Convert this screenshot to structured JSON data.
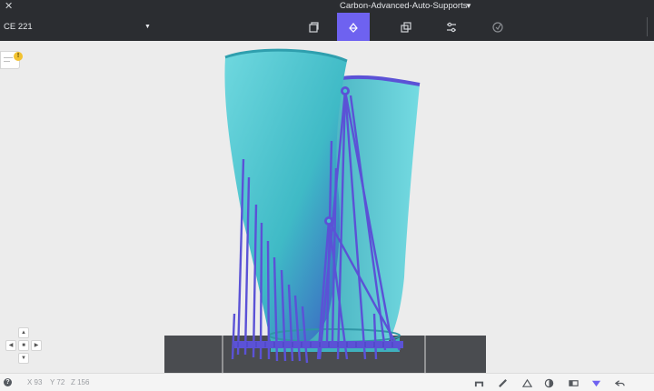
{
  "window": {
    "title": "Carbon-Advanced-Auto-Supports",
    "close_glyph": "✕",
    "title_caret": "▼"
  },
  "toolbar": {
    "printer": "CE 221",
    "printer_caret": "▼",
    "tools": [
      {
        "name": "orient-tool",
        "icon": "orient-icon",
        "active": false
      },
      {
        "name": "supports-tool",
        "icon": "supports-icon",
        "active": true
      },
      {
        "name": "duplicate-tool",
        "icon": "duplicate-icon",
        "active": false
      },
      {
        "name": "settings-tool",
        "icon": "sliders-icon",
        "active": false
      },
      {
        "name": "verify-tool",
        "icon": "check-circle-icon",
        "active": false
      }
    ],
    "accent": "#6e62f0"
  },
  "warning": {
    "badge": "!",
    "color": "#f2c230"
  },
  "viewport": {
    "model_color": "#45c2cc",
    "support_color": "#5b52d6",
    "platform_color": "#4a4c50",
    "background": "#ececec"
  },
  "navpad": {
    "up": "▲",
    "down": "▼",
    "left": "◀",
    "right": "▶",
    "center": "■"
  },
  "status": {
    "help": "?",
    "x": "X 93",
    "y": "Y 72",
    "z": "Z 156",
    "icons": [
      "platform-icon",
      "ruler-icon",
      "cross-section-icon",
      "contrast-icon",
      "split-view-icon",
      "supports-view-icon",
      "undo-icon"
    ]
  }
}
